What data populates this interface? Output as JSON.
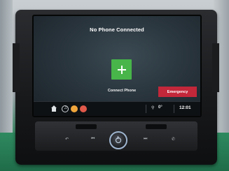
{
  "screen": {
    "title": "No Phone Connected",
    "connect_label": "Connect Phone",
    "emergency_label": "Emergency"
  },
  "status_bar": {
    "temperature": "0°",
    "time": "12:01"
  },
  "hardware": {
    "icons": [
      "back-icon",
      "prev-track-icon",
      "power-volume-knob",
      "next-track-icon",
      "phone-icon"
    ]
  },
  "colors": {
    "accent_green": "#47b54a",
    "emergency_red": "#c3273a"
  }
}
